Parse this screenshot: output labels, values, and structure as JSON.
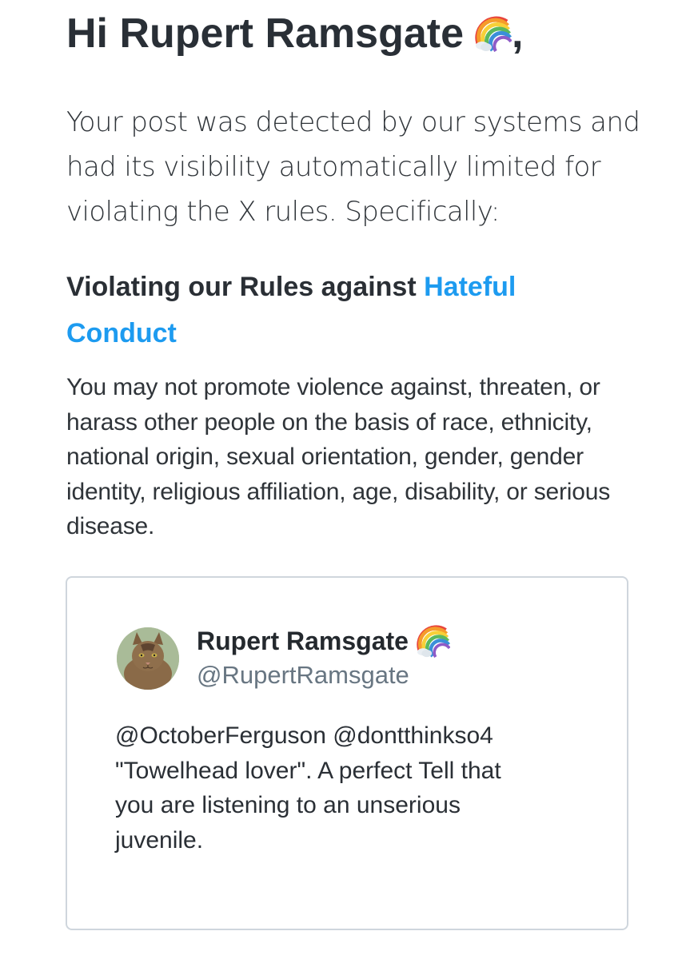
{
  "greeting": {
    "text": "Hi Rupert Ramsgate",
    "emoji": "rainbow-icon",
    "suffix": ","
  },
  "intro": "Your post was detected by our systems and had its visibility automatically limited for violating the X rules. Specifically:",
  "rule": {
    "title_prefix": "Violating our Rules against ",
    "link_text": "Hateful Conduct",
    "link_color": "#1d9bf0",
    "description": "You may not promote violence against, threaten, or harass other people on the basis of race, ethnicity, national origin, sexual orientation, gender, gender identity, religious affiliation, age, disability, or serious disease."
  },
  "tweet": {
    "author_name": "Rupert Ramsgate",
    "author_emoji": "rainbow-icon",
    "handle": "@RupertRamsgate",
    "avatar": "cat-avatar",
    "text": "@OctoberFerguson @dontthinkso4\n\"Towelhead lover\". A perfect Tell that\nyou are listening to an unserious\njuvenile."
  }
}
